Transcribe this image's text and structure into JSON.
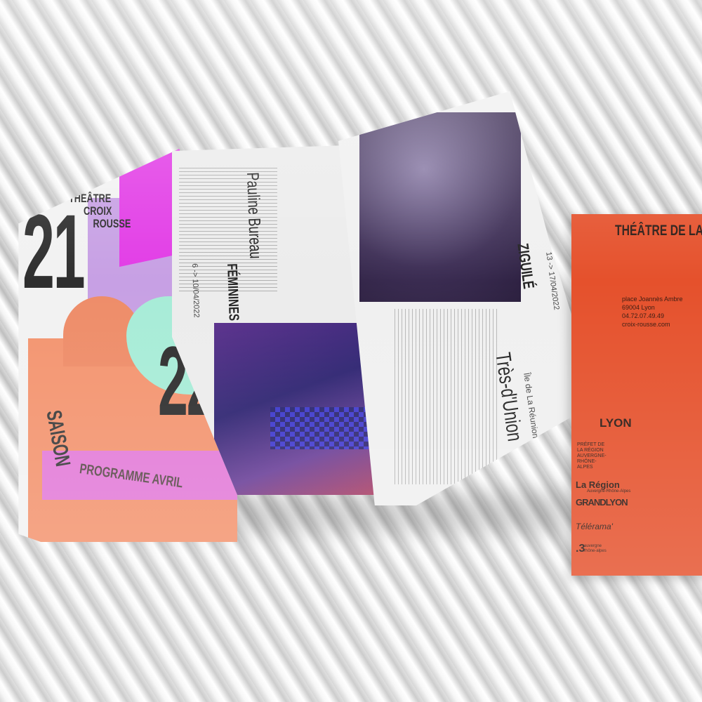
{
  "cover": {
    "num_21": "21",
    "num_22": "22",
    "title_line1": "THÉÂTRE",
    "title_line2": "CROIX",
    "title_line3": "ROUSSE",
    "saison": "SAISON",
    "programme": "PROGRAMME AVRIL"
  },
  "panel_feminines": {
    "date": "6 -> 10/04/2022",
    "title": "FÉMININES",
    "artist": "Pauline Bureau"
  },
  "panel_zigule": {
    "date": "13 -> 17/04/2022",
    "title": "ZIGUILÉ",
    "company": "Très-d'Union",
    "origin": "Île de La Réunion"
  },
  "booklet": {
    "title": "THÉÂTRE DE LA CROI",
    "address_line1": "place Joannès Ambre",
    "address_line2": "69004 Lyon",
    "phone": "04.72.07.49.49",
    "website": "croix-rousse.com",
    "ville": "LYON",
    "logo_prefet": "PRÉFET DE LA RÉGION AUVERGNE- RHÔNE-ALPES",
    "logo_region": "La Région",
    "logo_region_sub": "Auvergne-Rhône-Alpes",
    "logo_grandlyon": "GRANDLYON",
    "logo_telerama": "Télérama'",
    "logo_three": ".3",
    "logo_three_sub": "auvergne rhône-alpes"
  }
}
